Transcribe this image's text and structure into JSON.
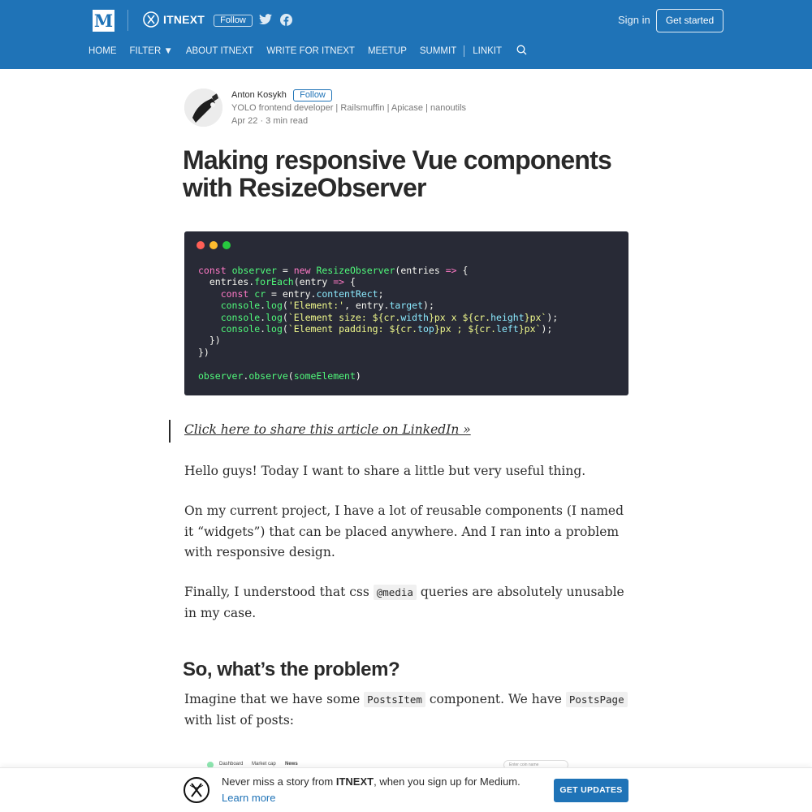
{
  "header": {
    "logo_letter": "M",
    "publication": "ITNEXT",
    "follow_label": "Follow",
    "signin_label": "Sign in",
    "get_started_label": "Get started",
    "brand_color": "#1f73b7"
  },
  "nav": {
    "items": [
      "HOME",
      "FILTER ▼",
      "ABOUT ITNEXT",
      "WRITE FOR ITNEXT",
      "MEETUP",
      "SUMMIT"
    ],
    "linkit_label": " LINKIT",
    "search_icon": "search-icon"
  },
  "author": {
    "name": "Anton Kosykh",
    "follow_label": "Follow",
    "bio": "YOLO frontend developer | Railsmuffin | Apicase | nanoutils",
    "meta": "Apr 22 · 3 min read"
  },
  "article": {
    "title": "Making responsive Vue components with ResizeObserver",
    "code_lines": [
      "const observer = new ResizeObserver(entries => {",
      "  entries.forEach(entry => {",
      "    const cr = entry.contentRect;",
      "    console.log('Element:', entry.target);",
      "    console.log(`Element size: ${cr.width}px x ${cr.height}px`);",
      "    console.log(`Element padding: ${cr.top}px ; ${cr.left}px`);",
      "  })",
      "})",
      "",
      "observer.observe(someElement)"
    ],
    "share_link": "Click here to share this article on LinkedIn »",
    "p1": "Hello guys! Today I want to share a little but very useful thing.",
    "p2": "On my current project, I have a lot of reusable components (I named it “widgets”) that can be placed anywhere. And I ran into a problem with responsive design.",
    "p3_before": "Finally, I understood that css ",
    "p3_code": "@media",
    "p3_after": " queries are absolutely unusable in my case.",
    "h2": "So, what’s the problem?",
    "p4_a": "Imagine that we have some ",
    "p4_code1": "PostsItem",
    "p4_b": " component. We have ",
    "p4_code2": "PostsPage",
    "p4_c": " with list of posts:",
    "image_labels": [
      "Dashboard",
      "Market cap",
      "News"
    ],
    "image_input_placeholder": "Enter coin name"
  },
  "bottom_bar": {
    "text_before": "Never miss a story from ",
    "text_brand": "ITNEXT",
    "text_after": ", when you sign up for Medium.",
    "learn_more": "Learn more",
    "button_label": "GET UPDATES"
  }
}
